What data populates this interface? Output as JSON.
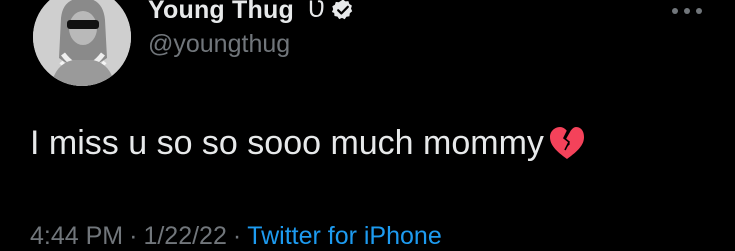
{
  "profile": {
    "display_name": "Young Thug",
    "name_glyph": "Ʋ",
    "handle": "@youngthug",
    "avatar_icon": "profile-photo",
    "verified_icon": "verified-badge-icon"
  },
  "actions": {
    "more_icon": "more-options-icon"
  },
  "tweet": {
    "text": "I miss u so so sooo much mommy",
    "emoji_icon": "broken-heart-icon"
  },
  "meta": {
    "time": "4:44 PM",
    "separator": "·",
    "date": "1/22/22",
    "source": "Twitter for iPhone"
  },
  "colors": {
    "background": "#000000",
    "text": "#e7e9ea",
    "secondary_text": "#71767b",
    "link": "#1d9bf0",
    "heart": "#f4425a"
  }
}
